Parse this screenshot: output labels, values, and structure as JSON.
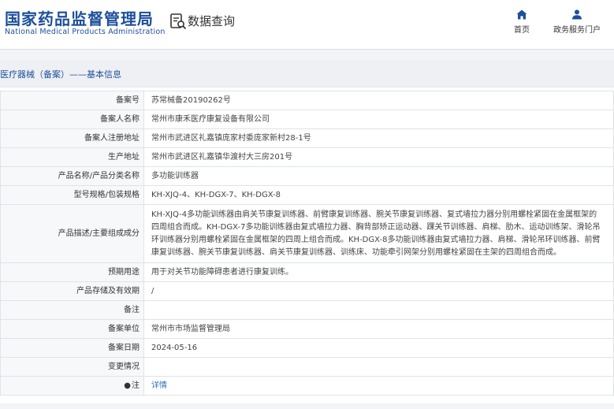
{
  "header": {
    "logo_cn": "国家药品监督管理局",
    "logo_en": "National Medical Products Administration",
    "db_title": "数据查询",
    "nav": [
      {
        "label": "首页",
        "icon": "home-icon"
      },
      {
        "label": "政务服务门户",
        "icon": "user-icon"
      }
    ]
  },
  "section": {
    "title": "医疗器械（备案）——基本信息"
  },
  "rows": [
    {
      "label": "备案号",
      "value": "苏常械备20190262号"
    },
    {
      "label": "备案人名称",
      "value": "常州市康禾医疗康复设备有限公司"
    },
    {
      "label": "备案人注册地址",
      "value": "常州市武进区礼嘉镇庞家村委庞家新村28-1号"
    },
    {
      "label": "生产地址",
      "value": "常州市武进区礼嘉镇华渡村大三房201号"
    },
    {
      "label": "产品名称/产品分类名称",
      "value": "多功能训练器"
    },
    {
      "label": "型号规格/包装规格",
      "value": "KH-XJQ-4、KH-DGX-7、KH-DGX-8"
    },
    {
      "label": "产品描述/主要组成成分",
      "value": "KH-XJQ-4多功能训练器由肩关节康复训练器、前臂康复训练器、腕关节康复训练器、复式墙拉力器分别用螺栓紧固在金属框架的四周组合而成。KH-DGX-7多功能训练器由复式墙拉力器、胸背部矫正运动器、踝关节训练器、肩梯、肋木、运动训练架、滑轮吊环训练器分别用螺栓紧固在金属框架的四周上组合而成。KH-DGX-8多功能训练器由复式墙拉力器、肩梯、滑轮吊环训练器、前臂康复训练器、腕关节康复训练器、肩关节康复训练器、训练床、功能牵引网架分别用螺栓紧固在主架的四周组合而成。"
    },
    {
      "label": "预期用途",
      "value": "用于对关节功能障碍患者进行康复训练。"
    },
    {
      "label": "产品存储及有效期",
      "value": "/"
    },
    {
      "label": "备注",
      "value": ""
    },
    {
      "label": "备案单位",
      "value": "常州市市场监督管理局"
    },
    {
      "label": "备案日期",
      "value": "2024-05-16"
    },
    {
      "label": "变更情况",
      "value": ""
    },
    {
      "label": "注",
      "value": "详情",
      "icon": "pin-icon"
    }
  ]
}
